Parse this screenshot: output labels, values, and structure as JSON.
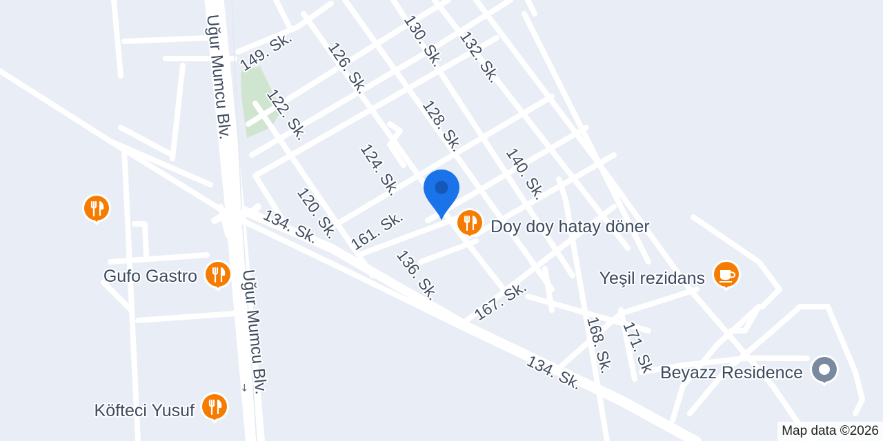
{
  "map": {
    "colors": {
      "land": "#e9edf5",
      "road": "#ffffff",
      "park": "#cfe5cf",
      "food_marker": "#f57c00",
      "lodging_marker": "#7a8a9e",
      "location_pin": "#1a73e8"
    },
    "streets": [
      {
        "id": "ugur-mumcu-north",
        "label": "Uğur Mumcu Blv."
      },
      {
        "id": "ugur-mumcu-south",
        "label": "Uğur Mumcu Blv."
      },
      {
        "id": "s149",
        "label": "149. Sk."
      },
      {
        "id": "s122",
        "label": "122. Sk."
      },
      {
        "id": "s126",
        "label": "126. Sk."
      },
      {
        "id": "s130",
        "label": "130. Sk."
      },
      {
        "id": "s132",
        "label": "132. Sk."
      },
      {
        "id": "s128",
        "label": "128. Sk."
      },
      {
        "id": "s124",
        "label": "124. Sk."
      },
      {
        "id": "s140",
        "label": "140. Sk."
      },
      {
        "id": "s120",
        "label": "120. Sk."
      },
      {
        "id": "s161",
        "label": "161. Sk."
      },
      {
        "id": "s134a",
        "label": "134. Sk."
      },
      {
        "id": "s136",
        "label": "136. Sk."
      },
      {
        "id": "s167",
        "label": "167. Sk."
      },
      {
        "id": "s168",
        "label": "168. Sk."
      },
      {
        "id": "s171",
        "label": "171. Sk"
      },
      {
        "id": "s134b",
        "label": "134. Sk."
      }
    ],
    "places": [
      {
        "id": "unnamed-restaurant",
        "label": "",
        "icon": "fork-knife-icon",
        "category": "food"
      },
      {
        "id": "gufo-gastro",
        "label": "Gufo Gastro",
        "icon": "fork-knife-icon",
        "category": "food"
      },
      {
        "id": "doy-doy",
        "label": "Doy doy hatay döner",
        "icon": "fork-knife-icon",
        "category": "food"
      },
      {
        "id": "yesil",
        "label": "Yeşil rezidans",
        "icon": "coffee-cup-icon",
        "category": "food"
      },
      {
        "id": "beyazz",
        "label": "Beyazz Residence",
        "icon": "hotel-icon",
        "category": "lodging"
      },
      {
        "id": "kofteci",
        "label": "Köfteci Yusuf",
        "icon": "fork-knife-icon",
        "category": "food"
      }
    ],
    "location_pin": {
      "icon": "location-pin-icon"
    },
    "attribution": "Map data ©2026"
  }
}
